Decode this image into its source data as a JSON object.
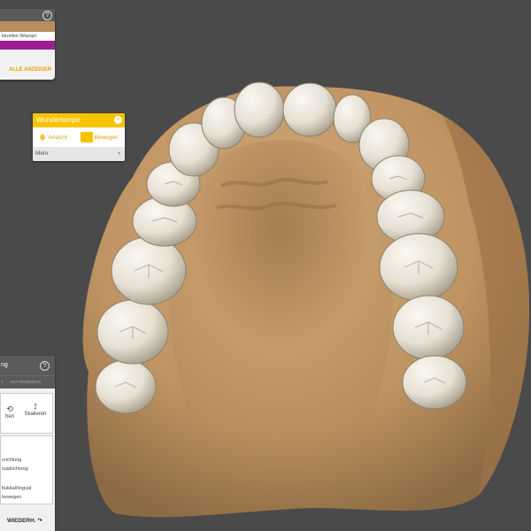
{
  "viewport": {
    "background": "#4a4a4a",
    "model_color": "#c59b6a",
    "tooth_color": "#e8e2d6",
    "model_label": "upper-jaw-dental-model"
  },
  "top_panel": {
    "help_icon": "question-circle-icon",
    "item_label": "ktuellen Wasspc",
    "accent_tan": "#b88d5c",
    "accent_purple": "#9b1d8e",
    "show_all": "ALLE ANZEIGEN"
  },
  "wunderlampe": {
    "title": "Wunderlampe",
    "close_icon": "close-icon",
    "buttons": [
      {
        "label": "Ansicht",
        "icon": "view-icon"
      },
      {
        "label": "Bewegen",
        "icon": "move-icon"
      }
    ],
    "more_label": "Mehr",
    "accent": "#f5c400"
  },
  "bottom_panel": {
    "title": "ng",
    "help_icon": "question-circle-icon",
    "tabs": [
      "T",
      "KETTENMODUS"
    ],
    "tools": [
      {
        "label": "hen",
        "icon": "rotate-icon"
      },
      {
        "label": "Skalieren",
        "icon": "scale-vertical-icon"
      }
    ],
    "options": [
      "srichtung",
      "sualrichtung",
      "bukkal/lingual",
      "bewegen"
    ],
    "redo_label": "WIEDERH.",
    "redo_icon": "redo-icon"
  }
}
